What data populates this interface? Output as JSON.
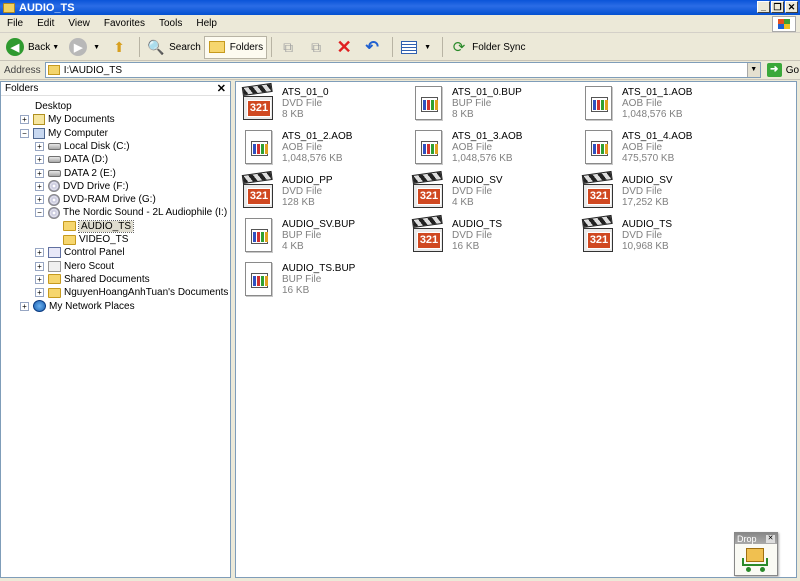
{
  "window": {
    "title": "AUDIO_TS",
    "icon": "folder-icon"
  },
  "titlebar_buttons": {
    "minimize": "_",
    "restore": "❐",
    "close": "✕"
  },
  "menu": [
    "File",
    "Edit",
    "View",
    "Favorites",
    "Tools",
    "Help"
  ],
  "toolbar": {
    "back_label": "Back",
    "search_label": "Search",
    "folders_label": "Folders",
    "foldersync_label": "Folder Sync",
    "icons": [
      "back-icon",
      "forward-icon",
      "up-folder-icon",
      "search-icon",
      "folders-icon",
      "move-to-icon",
      "copy-to-icon",
      "delete-icon",
      "undo-icon",
      "views-icon",
      "folder-sync-icon"
    ]
  },
  "address": {
    "label": "Address",
    "value": "I:\\AUDIO_TS",
    "go_label": "Go"
  },
  "folders_pane": {
    "title": "Folders",
    "close": "✕",
    "tree": [
      {
        "label": "Desktop",
        "indent": 0,
        "expander": "",
        "icon": "desktop"
      },
      {
        "label": "My Documents",
        "indent": 1,
        "expander": "+",
        "icon": "docs"
      },
      {
        "label": "My Computer",
        "indent": 1,
        "expander": "−",
        "icon": "pc"
      },
      {
        "label": "Local Disk (C:)",
        "indent": 2,
        "expander": "+",
        "icon": "drive"
      },
      {
        "label": "DATA (D:)",
        "indent": 2,
        "expander": "+",
        "icon": "drive"
      },
      {
        "label": "DATA 2 (E:)",
        "indent": 2,
        "expander": "+",
        "icon": "drive"
      },
      {
        "label": "DVD Drive (F:)",
        "indent": 2,
        "expander": "+",
        "icon": "cd"
      },
      {
        "label": "DVD-RAM Drive (G:)",
        "indent": 2,
        "expander": "+",
        "icon": "cd"
      },
      {
        "label": "The Nordic Sound - 2L Audiophile (I:)",
        "indent": 2,
        "expander": "−",
        "icon": "cd"
      },
      {
        "label": "AUDIO_TS",
        "indent": 3,
        "expander": "",
        "icon": "folder",
        "selected": true
      },
      {
        "label": "VIDEO_TS",
        "indent": 3,
        "expander": "",
        "icon": "folder"
      },
      {
        "label": "Control Panel",
        "indent": 2,
        "expander": "+",
        "icon": "cpl"
      },
      {
        "label": "Nero Scout",
        "indent": 2,
        "expander": "+",
        "icon": "nero"
      },
      {
        "label": "Shared Documents",
        "indent": 2,
        "expander": "+",
        "icon": "folder"
      },
      {
        "label": "NguyenHoangAnhTuan's Documents",
        "indent": 2,
        "expander": "+",
        "icon": "folder"
      },
      {
        "label": "My Network Places",
        "indent": 1,
        "expander": "+",
        "icon": "net"
      }
    ]
  },
  "files": [
    {
      "name": "ATS_01_0",
      "type": "DVD File",
      "size": "8 KB",
      "icon": "dvd"
    },
    {
      "name": "ATS_01_0.BUP",
      "type": "BUP File",
      "size": "8 KB",
      "icon": "generic"
    },
    {
      "name": "ATS_01_1.AOB",
      "type": "AOB File",
      "size": "1,048,576 KB",
      "icon": "generic"
    },
    {
      "name": "ATS_01_2.AOB",
      "type": "AOB File",
      "size": "1,048,576 KB",
      "icon": "generic"
    },
    {
      "name": "ATS_01_3.AOB",
      "type": "AOB File",
      "size": "1,048,576 KB",
      "icon": "generic"
    },
    {
      "name": "ATS_01_4.AOB",
      "type": "AOB File",
      "size": "475,570 KB",
      "icon": "generic"
    },
    {
      "name": "AUDIO_PP",
      "type": "DVD File",
      "size": "128 KB",
      "icon": "dvd"
    },
    {
      "name": "AUDIO_SV",
      "type": "DVD File",
      "size": "4 KB",
      "icon": "dvd"
    },
    {
      "name": "AUDIO_SV",
      "type": "DVD File",
      "size": "17,252 KB",
      "icon": "dvd"
    },
    {
      "name": "AUDIO_SV.BUP",
      "type": "BUP File",
      "size": "4 KB",
      "icon": "generic"
    },
    {
      "name": "AUDIO_TS",
      "type": "DVD File",
      "size": "16 KB",
      "icon": "dvd"
    },
    {
      "name": "AUDIO_TS",
      "type": "DVD File",
      "size": "10,968 KB",
      "icon": "dvd"
    },
    {
      "name": "AUDIO_TS.BUP",
      "type": "BUP File",
      "size": "16 KB",
      "icon": "generic"
    }
  ],
  "icon_badge_text": "321",
  "drop_widget": {
    "title": "Drop",
    "close": "✕",
    "icon": "shopping-cart-icon"
  },
  "colors": {
    "titlebar": "#0a54d8",
    "window_bg": "#ece9d8",
    "badge": "#d04820"
  }
}
